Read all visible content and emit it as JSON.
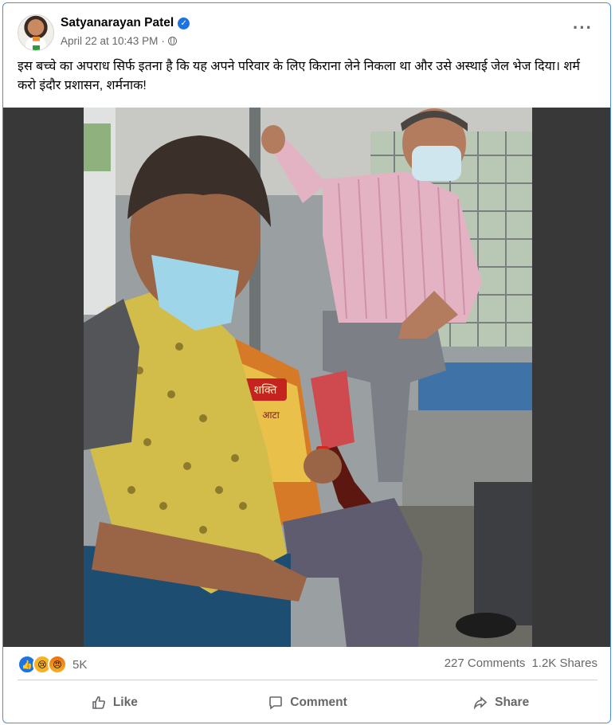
{
  "post": {
    "author": "Satyanarayan Patel",
    "timestamp": "April 22 at 10:43 PM",
    "separator": "·",
    "text": "इस बच्चे का अपराध सिर्फ इतना है कि यह अपने परिवार के लिए किराना लेने निकला था और उसे अस्थाई जेल भेज दिया। शर्म करो इंदौर प्रशासन, शर्मनाक!",
    "more_icon": "more-options-icon"
  },
  "photo": {
    "package_brand": "शक्ति",
    "package_word": "आटा"
  },
  "stats": {
    "reaction_count": "5K",
    "comments": "227 Comments",
    "shares": "1.2K Shares"
  },
  "actions": {
    "like": "Like",
    "comment": "Comment",
    "share": "Share"
  },
  "colors": {
    "accent": "#1b74e4",
    "secondary_text": "#65676b"
  }
}
